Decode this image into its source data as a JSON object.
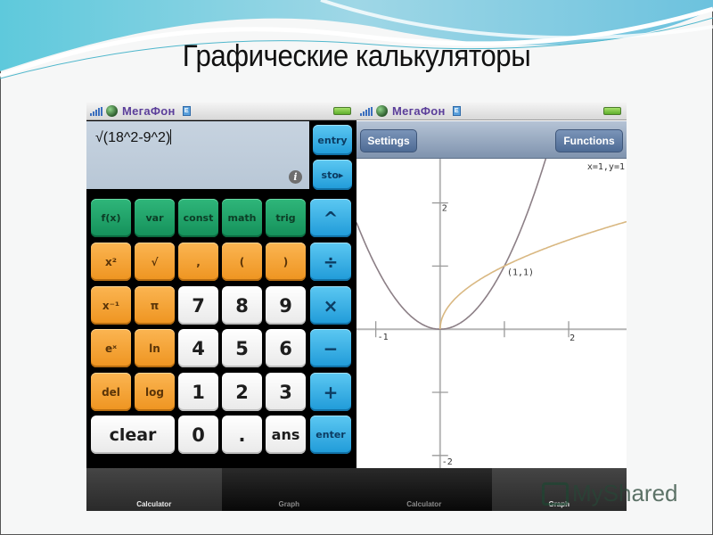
{
  "slide": {
    "title": "Графические калькуляторы",
    "watermark": "MyShared"
  },
  "status_bar": {
    "carrier": "МегаФон",
    "network_icon": "edge-icon",
    "network_label": "E"
  },
  "calculator": {
    "expression": "√(18^2-9^2)",
    "info_icon": "i",
    "side_keys": [
      "entry",
      "sto▸"
    ],
    "keys": [
      {
        "label": "f(x)",
        "color": "green"
      },
      {
        "label": "var",
        "color": "green"
      },
      {
        "label": "const",
        "color": "green"
      },
      {
        "label": "math",
        "color": "green"
      },
      {
        "label": "trig",
        "color": "green"
      },
      {
        "label": "^",
        "color": "blue"
      },
      {
        "label": "x²",
        "color": "orange"
      },
      {
        "label": "√",
        "color": "orange"
      },
      {
        "label": ",",
        "color": "orange"
      },
      {
        "label": "(",
        "color": "orange"
      },
      {
        "label": ")",
        "color": "orange"
      },
      {
        "label": "÷",
        "color": "blue"
      },
      {
        "label": "x⁻¹",
        "color": "orange"
      },
      {
        "label": "π",
        "color": "orange"
      },
      {
        "label": "7",
        "color": "white"
      },
      {
        "label": "8",
        "color": "white"
      },
      {
        "label": "9",
        "color": "white"
      },
      {
        "label": "×",
        "color": "blue"
      },
      {
        "label": "eˣ",
        "color": "orange"
      },
      {
        "label": "ln",
        "color": "orange"
      },
      {
        "label": "4",
        "color": "white"
      },
      {
        "label": "5",
        "color": "white"
      },
      {
        "label": "6",
        "color": "white"
      },
      {
        "label": "−",
        "color": "blue"
      },
      {
        "label": "del",
        "color": "orange"
      },
      {
        "label": "log",
        "color": "orange"
      },
      {
        "label": "1",
        "color": "white"
      },
      {
        "label": "2",
        "color": "white"
      },
      {
        "label": "3",
        "color": "white"
      },
      {
        "label": "+",
        "color": "blue"
      },
      {
        "label": "clear",
        "color": "white"
      },
      {
        "label": "0",
        "color": "white"
      },
      {
        "label": ".",
        "color": "white"
      },
      {
        "label": "ans",
        "color": "white"
      },
      {
        "label": "enter",
        "color": "blue"
      }
    ],
    "tabs": [
      {
        "label": "Calculator",
        "active": true
      },
      {
        "label": "Graph",
        "active": false
      }
    ]
  },
  "graph": {
    "settings_label": "Settings",
    "functions_label": "Functions",
    "cursor_readout": "x=1,y=1",
    "intersection_label": "(1,1)",
    "x_tick_labels": [
      "-1",
      "2"
    ],
    "y_tick_labels": [
      "2",
      "-2"
    ],
    "curve_colors": {
      "parabola": "#8c7f86",
      "sqrt": "#d9b882"
    },
    "tabs": [
      {
        "label": "Calculator",
        "active": false
      },
      {
        "label": "Graph",
        "active": true
      }
    ]
  },
  "chart_data": {
    "type": "line",
    "title": "",
    "xlabel": "",
    "ylabel": "",
    "xlim": [
      -1.3,
      2.9
    ],
    "ylim": [
      -2.2,
      2.7
    ],
    "x_ticks": [
      -1,
      1,
      2
    ],
    "y_ticks": [
      -2,
      -1,
      1,
      2
    ],
    "grid": false,
    "series": [
      {
        "name": "y = x^2",
        "expression": "x^2"
      },
      {
        "name": "y = sqrt(x)",
        "expression": "sqrt(x)"
      }
    ],
    "annotations": [
      {
        "text": "(1,1)",
        "x": 1,
        "y": 1
      },
      {
        "text": "x=1,y=1",
        "position": "top-right"
      }
    ]
  }
}
